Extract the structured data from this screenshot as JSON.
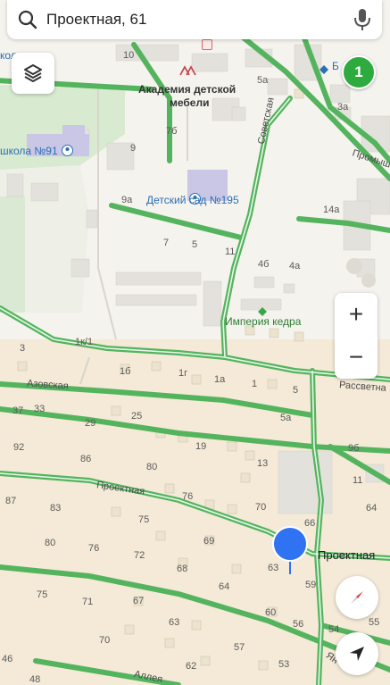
{
  "search": {
    "query": "Проектная, 61"
  },
  "badge": {
    "count": "1"
  },
  "zoom": {
    "in_label": "+",
    "out_label": "−"
  },
  "colors": {
    "road": "#54b45e",
    "pin": "#2f72f2",
    "badge": "#2eab3f"
  },
  "pois": {
    "furniture_academy_line1": "Академия детской",
    "furniture_academy_line2": "мебели",
    "school": "школа №91",
    "kindergarten": "Детский сад №195",
    "cedar_empire": "Империя кедра",
    "top_left_partial": "кола",
    "top_right_partial": "Б"
  },
  "streets": {
    "sovetskaya": "Советская",
    "promysh": "Промыш",
    "azovskaya": "Азовская",
    "rassvetnaya": "Рассветна",
    "proektnaya": "Проектная",
    "proektnaya_right": "Проектная",
    "yan": "Ян",
    "alley": "Аллея"
  },
  "house_numbers": {
    "h10": "10",
    "h5a_top": "5а",
    "h3a": "3а",
    "h7b": "7б",
    "h9": "9",
    "h9a": "9а",
    "h14a": "14а",
    "h7": "7",
    "h5": "5",
    "h11": "11",
    "h4b": "4б",
    "h4a": "4а",
    "h3": "3",
    "h1k1": "1к/1",
    "h1b": "1б",
    "h1g": "1г",
    "h1a": "1а",
    "h1": "1",
    "h5b": "5",
    "h37": "37",
    "h33": "33",
    "h25": "25",
    "h5a": "5а",
    "h29": "29",
    "h92": "92",
    "h19": "19",
    "h9b": "9б",
    "h86": "86",
    "h13": "13",
    "h80": "80",
    "h11b": "11",
    "h87": "87",
    "h83": "83",
    "h76a": "76",
    "h64": "64",
    "h70a": "70",
    "h75": "75",
    "h66": "66",
    "h80b": "80",
    "h76b": "76",
    "h72": "72",
    "h69": "69",
    "h68": "68",
    "h63": "63",
    "h59": "59",
    "h64b": "64",
    "h75b": "75",
    "h71": "71",
    "h67": "67",
    "h60": "60",
    "h63b": "63",
    "h56": "56",
    "h55": "55",
    "h54": "54",
    "h70b": "70",
    "h57": "57",
    "h62": "62",
    "h53": "53",
    "h46": "46",
    "h48": "48"
  }
}
